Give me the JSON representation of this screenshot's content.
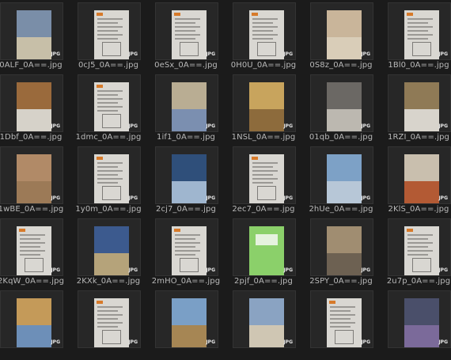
{
  "badge_label": "JPG",
  "files": [
    {
      "name": "0ALF_0A==.jpg",
      "kind": "photo",
      "c1": "#7a8ea8",
      "c2": "#c7bfa8"
    },
    {
      "name": "0cJ5_0A==.jpg",
      "kind": "doc"
    },
    {
      "name": "0eSx_0A==.jpg",
      "kind": "doc"
    },
    {
      "name": "0H0U_0A==.jpg",
      "kind": "doc"
    },
    {
      "name": "0S8z_0A==.jpg",
      "kind": "photo",
      "c1": "#c9b59a",
      "c2": "#d9cdb8"
    },
    {
      "name": "1Bl0_0A==.jpg",
      "kind": "doc"
    },
    {
      "name": "1Dbf_0A==.jpg",
      "kind": "photo",
      "c1": "#9a6a3c",
      "c2": "#d6d2c9"
    },
    {
      "name": "1dmc_0A==.jpg",
      "kind": "doc"
    },
    {
      "name": "1if1_0A==.jpg",
      "kind": "photo",
      "c1": "#b9ad93",
      "c2": "#7b8fb0"
    },
    {
      "name": "1NSL_0A==.jpg",
      "kind": "photo",
      "c1": "#c8a45d",
      "c2": "#8d6b3c"
    },
    {
      "name": "01qb_0A==.jpg",
      "kind": "photo",
      "c1": "#6b6864",
      "c2": "#bcb8b0"
    },
    {
      "name": "1RZI_0A==.jpg",
      "kind": "photo",
      "c1": "#8f7a56",
      "c2": "#d8d4cc"
    },
    {
      "name": "1wBE_0A==.jpg",
      "kind": "photo",
      "c1": "#b18a67",
      "c2": "#9c7a57"
    },
    {
      "name": "1y0m_0A==.jpg",
      "kind": "doc"
    },
    {
      "name": "2cj7_0A==.jpg",
      "kind": "photo",
      "c1": "#2f4f7a",
      "c2": "#9fb6cf"
    },
    {
      "name": "2ec7_0A==.jpg",
      "kind": "doc"
    },
    {
      "name": "2hUe_0A==.jpg",
      "kind": "photo",
      "c1": "#7da1c6",
      "c2": "#b7c7d7"
    },
    {
      "name": "2KlS_0A==.jpg",
      "kind": "photo",
      "c1": "#c9bfae",
      "c2": "#b35a34"
    },
    {
      "name": "2KqW_0A==.jpg",
      "kind": "doc"
    },
    {
      "name": "2KXk_0A==.jpg",
      "kind": "photo",
      "c1": "#3c5a8e",
      "c2": "#b5a37a"
    },
    {
      "name": "2mHO_0A==.jpg",
      "kind": "doc"
    },
    {
      "name": "2pjf_0A==.jpg",
      "kind": "green"
    },
    {
      "name": "2SPY_0A==.jpg",
      "kind": "photo",
      "c1": "#a08d71",
      "c2": "#6d6152"
    },
    {
      "name": "2u7p_0A==.jpg",
      "kind": "doc"
    },
    {
      "name": "",
      "kind": "photo",
      "c1": "#c49a59",
      "c2": "#6d8fb8"
    },
    {
      "name": "",
      "kind": "doc"
    },
    {
      "name": "",
      "kind": "photo",
      "c1": "#7a9fc6",
      "c2": "#a68654"
    },
    {
      "name": "",
      "kind": "photo",
      "c1": "#8aa3c2",
      "c2": "#cfc6b3"
    },
    {
      "name": "",
      "kind": "doc"
    },
    {
      "name": "",
      "kind": "photo",
      "c1": "#4a4f6a",
      "c2": "#7b6a9a"
    }
  ]
}
